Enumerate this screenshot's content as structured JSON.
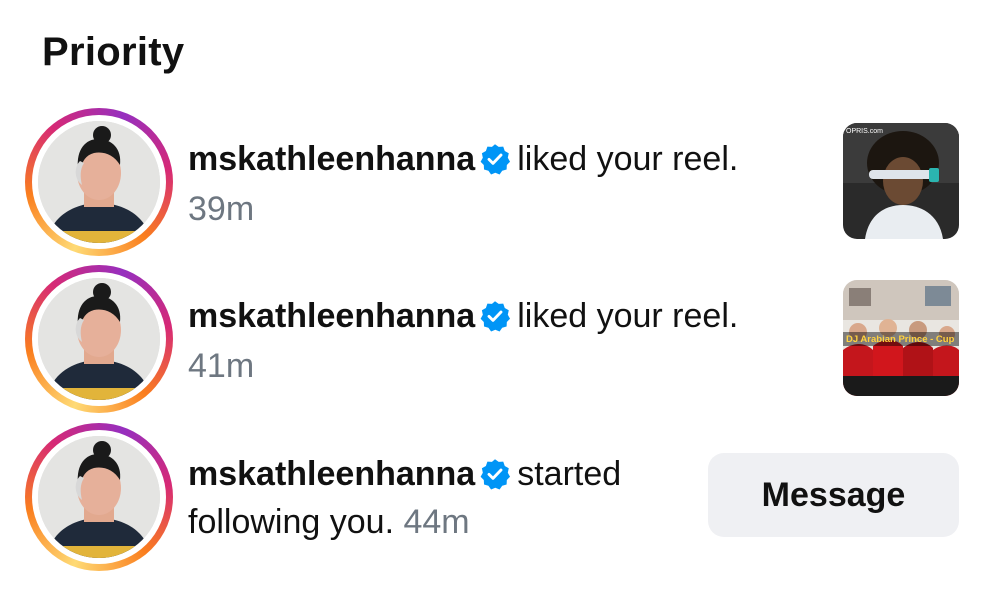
{
  "section": {
    "title": "Priority"
  },
  "notifications": [
    {
      "username": "mskathleenhanna",
      "action": "liked your reel.",
      "time": "39m",
      "verified_icon": "verified-badge-icon",
      "thumbnail": {
        "watermark": "OPRIS.com"
      }
    },
    {
      "username": "mskathleenhanna",
      "action": "liked your reel.",
      "time": "41m",
      "verified_icon": "verified-badge-icon",
      "thumbnail": {
        "caption": "DJ Arabian Prince - Cup"
      }
    },
    {
      "username": "mskathleenhanna",
      "action": "started following you.",
      "time": "44m",
      "verified_icon": "verified-badge-icon",
      "button_label": "Message"
    }
  ],
  "colors": {
    "verified": "#0095f6",
    "timestamp": "#6e7781",
    "button_bg": "#eff0f3",
    "ring_gradient": [
      "#feda75",
      "#fa7e1e",
      "#d62976",
      "#962fbf"
    ]
  }
}
